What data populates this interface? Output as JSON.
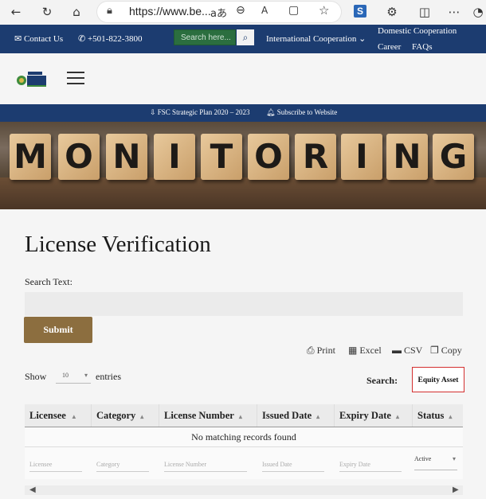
{
  "browser": {
    "url": "https://www.be...",
    "read_aloud": "aあ",
    "ext_letter": "S"
  },
  "topbar": {
    "contact": "Contact Us",
    "phone": "+501-822-3800",
    "search_placeholder": "Search here...",
    "intl": "International Cooperation",
    "domestic": "Domestic Cooperation",
    "career": "Career",
    "faqs": "FAQs"
  },
  "band": {
    "strategic": "FSC Strategic Plan 2020 – 2023",
    "subscribe": "Subscribe to Website"
  },
  "hero": {
    "letters": [
      "M",
      "O",
      "N",
      "I",
      "T",
      "O",
      "R",
      "I",
      "N",
      "G"
    ]
  },
  "main": {
    "title": "License Verification",
    "search_text_label": "Search Text:",
    "submit": "Submit",
    "print": "Print",
    "excel": "Excel",
    "csv": "CSV",
    "copy": "Copy",
    "show": "Show",
    "entries_value": "10",
    "entries": "entries",
    "search_label": "Search:",
    "search_value": "Equity Asset"
  },
  "table": {
    "headers": [
      "Licensee",
      "Category",
      "License Number",
      "Issued Date",
      "Expiry Date",
      "Status"
    ],
    "empty": "No matching records found",
    "filters": [
      "Licensee",
      "Category",
      "License Number",
      "Issued Date",
      "Expiry Date"
    ],
    "status_filter": "Active"
  }
}
